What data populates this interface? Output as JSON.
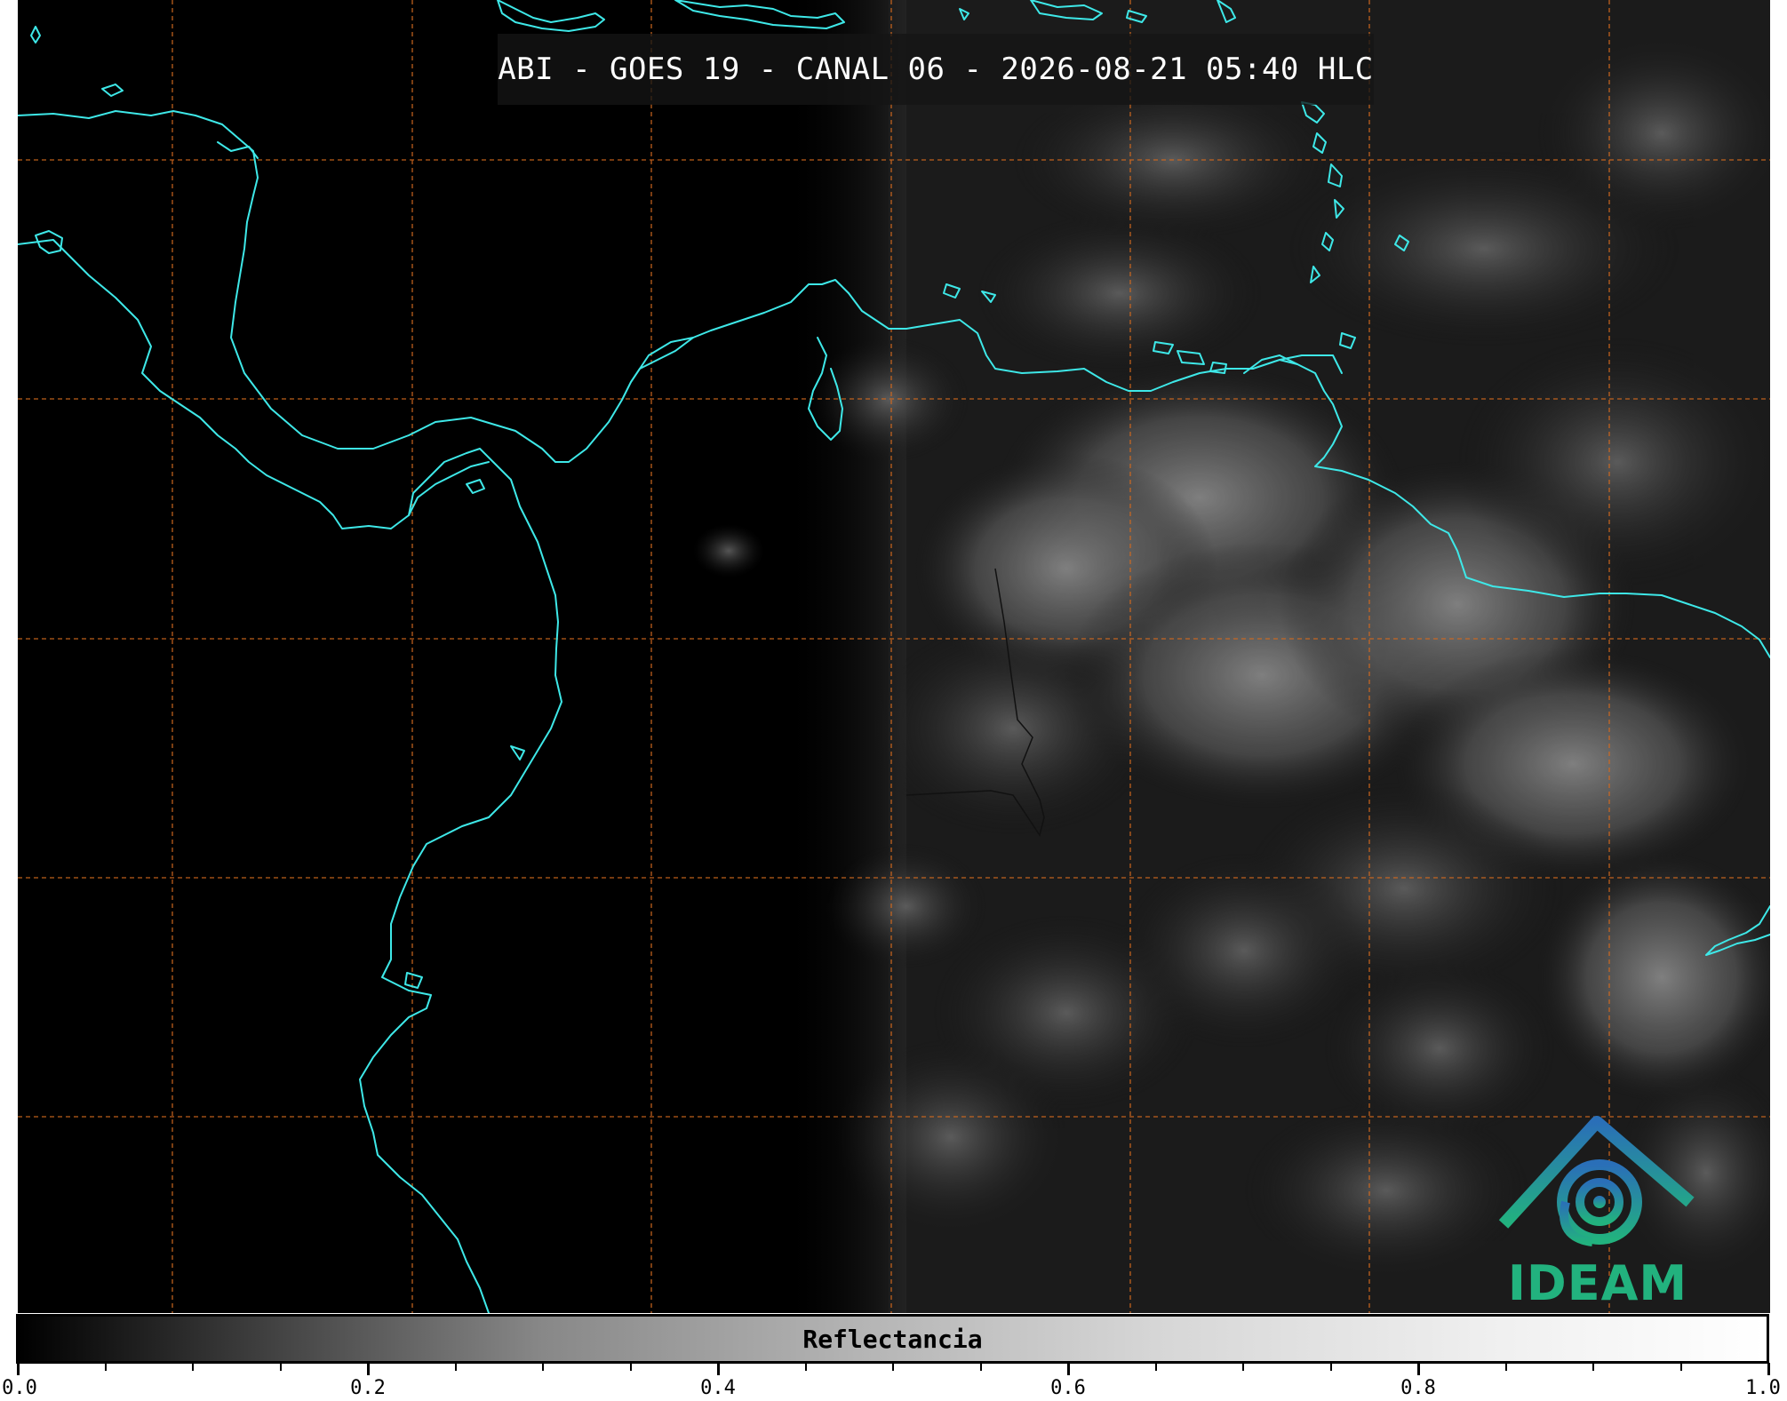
{
  "title": "ABI - GOES 19 - CANAL 06 - 2026-08-21 05:40 HLC",
  "map": {
    "coastline_color": "#3ee8e8",
    "grid_color": "#d2691e",
    "grid_style": "dashed",
    "background": "#000000",
    "cloud_color": "#6a6a6a"
  },
  "colorbar": {
    "label": "Reflectancia",
    "range": [
      0.0,
      1.0
    ],
    "tick_labels": [
      "0.0",
      "0.2",
      "0.4",
      "0.6",
      "0.8",
      "1.0"
    ],
    "minor_divisions": 20,
    "colormap": "grayscale"
  },
  "logo": {
    "text": "IDEAM",
    "color": "#22b27e"
  }
}
